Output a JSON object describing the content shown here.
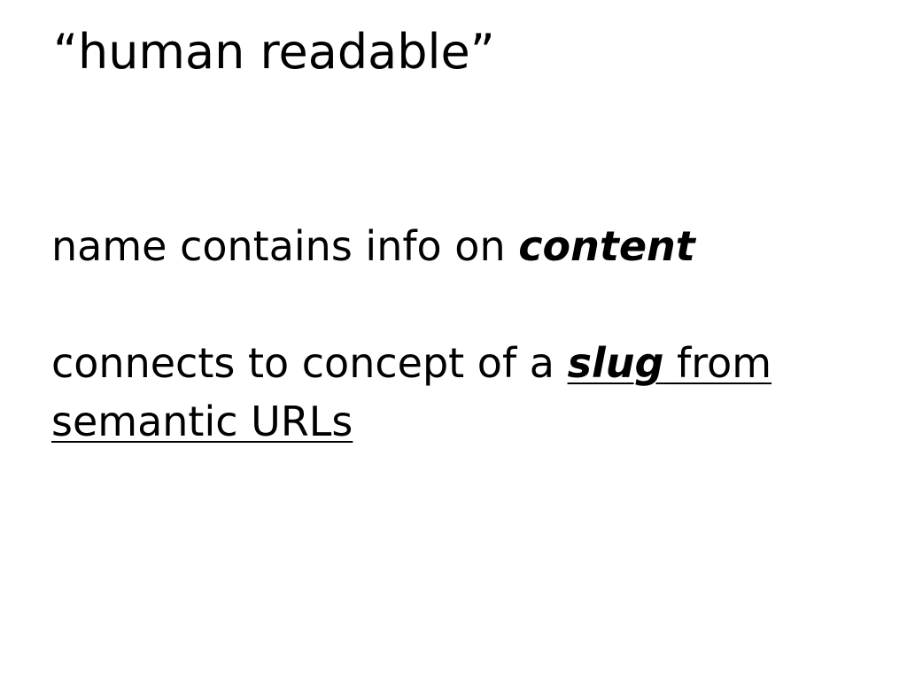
{
  "slide": {
    "title": "“human readable”",
    "point1": {
      "lead": "name contains info on ",
      "emphasis": "content"
    },
    "point2": {
      "lead": "connects to concept of a ",
      "slug": "slug",
      "link_rest": " from semantic URLs"
    }
  },
  "colors": {
    "background": "#ffffff",
    "text": "#000000"
  }
}
